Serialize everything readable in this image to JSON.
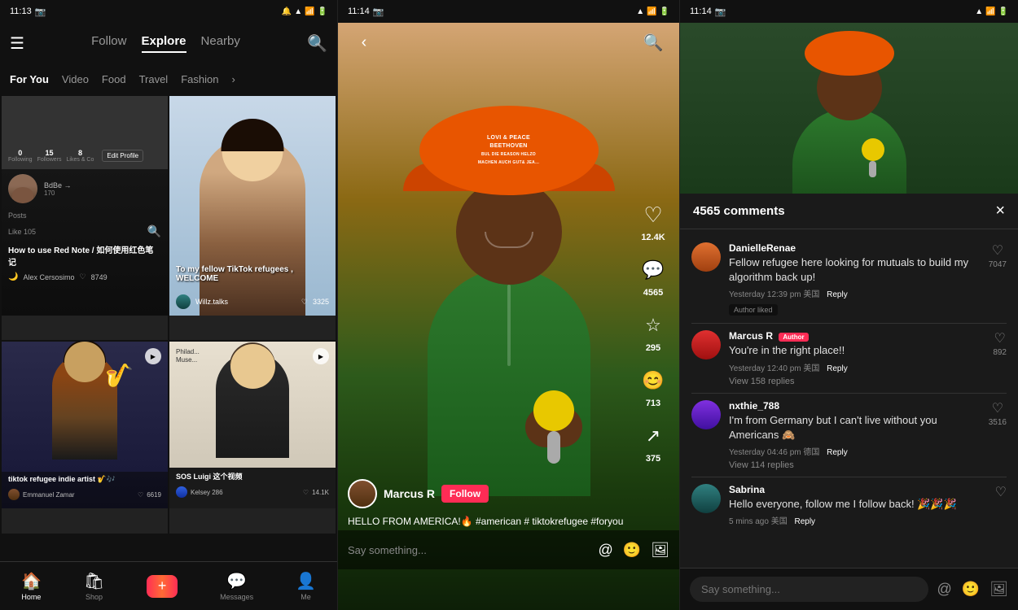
{
  "phone1": {
    "status": {
      "time": "11:13",
      "icons": "📷"
    },
    "nav": {
      "follow_label": "Follow",
      "explore_label": "Explore",
      "nearby_label": "Nearby"
    },
    "subtabs": [
      "For You",
      "Video",
      "Food",
      "Travel",
      "Fashion"
    ],
    "cards": [
      {
        "title": "How to use Red Note / 如何使用红色笔记",
        "username": "Alex Cersosimo",
        "likes": "8749"
      },
      {
        "title": "To my fellow TikTok refugees , WELCOME",
        "username": "Willz.talks",
        "likes": "3325"
      },
      {
        "title": "tiktok refugee indie artist 🎷🎶",
        "username": "Emmanuel Zamar",
        "likes": "6619"
      },
      {
        "title": "SOS Luigi 这个视频",
        "username": "Kelsey 286",
        "likes": "14.1K"
      }
    ],
    "bottomnav": {
      "home": "Home",
      "shop": "Shop",
      "add": "+",
      "messages": "Messages",
      "me": "Me"
    }
  },
  "phone2": {
    "status": {
      "time": "11:14"
    },
    "creator": "Marcus R",
    "follow_btn": "Follow",
    "caption": "HELLO FROM AMERICA!🔥 #american # tiktokrefugee #foryou",
    "likes": "12.4K",
    "comments": "4565",
    "bookmarks": "295",
    "shares_label": "713",
    "music_label": "375",
    "comment_placeholder": "Say something..."
  },
  "phone3": {
    "status": {
      "time": "11:14"
    },
    "comments_title": "4565 comments",
    "close_btn": "×",
    "comments": [
      {
        "username": "DanielleRenae",
        "text": "Fellow refugee here looking for mutuals to build my algorithm back up!",
        "meta": "Yesterday 12:39 pm 美国",
        "reply_label": "Reply",
        "liked": true,
        "author_liked": "Author liked",
        "hearts": "7047",
        "view_replies": ""
      },
      {
        "username": "Marcus R",
        "author_badge": "Author",
        "text": "You're in the right place!!",
        "meta": "Yesterday 12:40 pm 美国",
        "reply_label": "Reply",
        "hearts": "892",
        "view_replies": "View 158 replies"
      },
      {
        "username": "nxthie_788",
        "text": "I'm from Germany but I can't live without you Americans 🙈",
        "meta": "Yesterday 04:46 pm 德国",
        "reply_label": "Reply",
        "hearts": "3516",
        "view_replies": "View 114 replies"
      },
      {
        "username": "Sabrina",
        "text": "Hello everyone, follow me I follow back! 🎉🎉🎉",
        "meta": "5 mins ago 美国",
        "reply_label": "Reply",
        "hearts": "",
        "view_replies": ""
      }
    ],
    "input_placeholder": "Say something..."
  }
}
